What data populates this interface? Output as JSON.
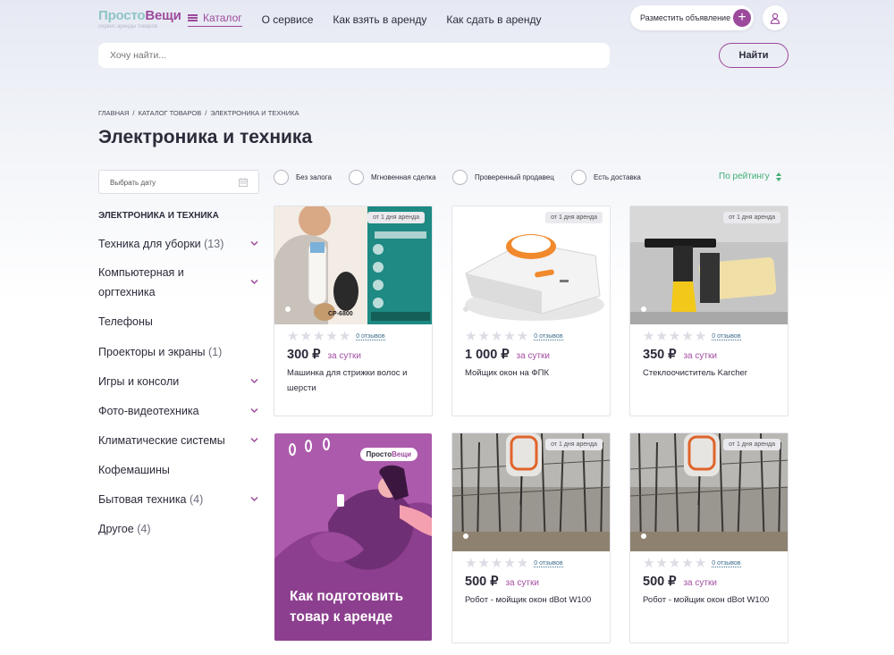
{
  "header": {
    "logo_part1": "Просто",
    "logo_part2": "Вещи",
    "logo_tagline": "сервис аренды товаров",
    "nav": {
      "catalog": "Каталог",
      "about": "О сервисе",
      "how_rent": "Как взять в аренду",
      "how_lease": "Как сдать в аренду"
    },
    "post_ad": "Разместить объявление"
  },
  "search": {
    "placeholder": "Хочу найти...",
    "button": "Найти"
  },
  "breadcrumb": [
    "ГЛАВНАЯ",
    "КАТАЛОГ ТОВАРОВ",
    "ЭЛЕКТРОНИКА И ТЕХНИКА"
  ],
  "page_title": "Электроника и техника",
  "date_picker": {
    "placeholder": "Выбрать дату"
  },
  "sidebar": {
    "heading": "ЭЛЕКТРОНИКА И ТЕХНИКА",
    "items": [
      {
        "label": "Техника для уборки",
        "count": "(13)"
      },
      {
        "label": "Компьютерная и оргтехника",
        "count": ""
      },
      {
        "label": "Телефоны",
        "count": ""
      },
      {
        "label": "Проекторы и экраны",
        "count": "(1)"
      },
      {
        "label": "Игры и консоли",
        "count": ""
      },
      {
        "label": "Фото-видеотехника",
        "count": ""
      },
      {
        "label": "Климатические системы",
        "count": ""
      },
      {
        "label": "Кофемашины",
        "count": ""
      },
      {
        "label": "Бытовая техника",
        "count": "(4)"
      },
      {
        "label": "Другое",
        "count": "(4)"
      }
    ]
  },
  "filters": {
    "no_deposit": "Без залога",
    "instant": "Мгновенная сделка",
    "verified": "Проверенный продавец",
    "delivery": "Есть доставка",
    "sort": "По рейтингу"
  },
  "products": [
    {
      "badge": "от 1 дня аренда",
      "reviews": "0 отзывов",
      "price": "300 ₽",
      "per": "за сутки",
      "title": "Машинка для стрижки волос и шерсти",
      "image_label": "CP-6800"
    },
    {
      "badge": "от 1 дня аренда",
      "reviews": "0 отзывов",
      "price": "1 000 ₽",
      "per": "за сутки",
      "title": "Мойщик окон на ФПК"
    },
    {
      "badge": "от 1 дня аренда",
      "reviews": "0 отзывов",
      "price": "350 ₽",
      "per": "за сутки",
      "title": "Стеклоочиститель Karcher"
    },
    {
      "badge": "от 1 дня аренда",
      "reviews": "0 отзывов",
      "price": "500 ₽",
      "per": "за сутки",
      "title": "Робот - мойщик окон dBot W100"
    },
    {
      "badge": "от 1 дня аренда",
      "reviews": "0 отзывов",
      "price": "500 ₽",
      "per": "за сутки",
      "title": "Робот - мойщик окон dBot W100"
    }
  ],
  "promo": {
    "logo_part1": "Просто",
    "logo_part2": "Вещи",
    "text": "Как подготовить товар к аренде"
  },
  "colors": {
    "brand_purple": "#9c4a9c",
    "brand_teal": "#8ec5c7",
    "sort_green": "#3fae74",
    "promo_bg": "#ac5aac"
  },
  "icons": [
    "burger-menu-icon",
    "plus-icon",
    "user-icon",
    "calendar-icon",
    "chevron-down-icon",
    "sort-arrows-icon",
    "star-icon"
  ]
}
